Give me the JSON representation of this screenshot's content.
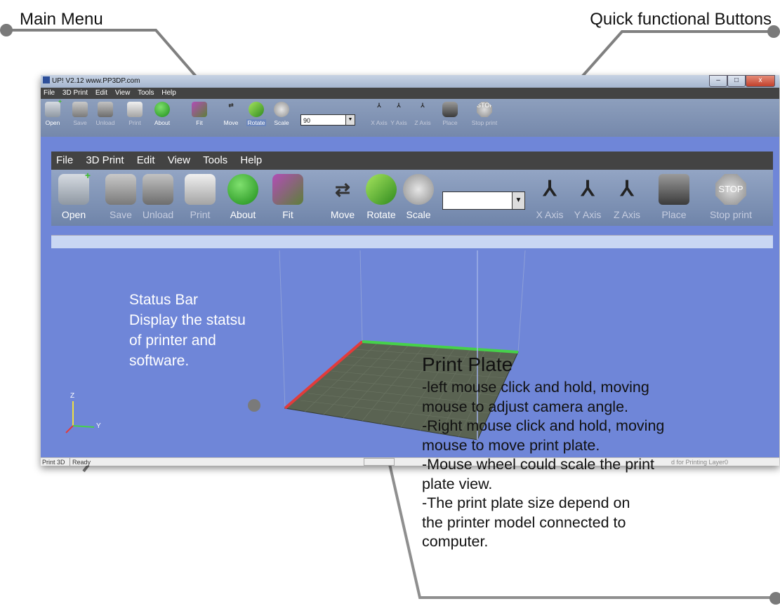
{
  "callouts": {
    "main_menu": "Main Menu",
    "quick_buttons": "Quick functional Buttons",
    "status_bar": [
      "Status Bar",
      "Display the statsu",
      "of printer and",
      "software."
    ],
    "print_plate_title": "Print Plate",
    "print_plate_lines": [
      "-left mouse click and hold, moving",
      "mouse to adjust camera angle.",
      "-Right mouse click and hold, moving",
      "mouse to move print plate.",
      "-Mouse wheel could scale the print",
      "plate view.",
      "-The print plate size depend on",
      "the printer model connected to",
      "computer."
    ]
  },
  "window": {
    "title": "UP!  V2.12 www.PP3DP.com",
    "controls": [
      "–",
      "□",
      "x"
    ]
  },
  "menu": [
    "File",
    "3D Print",
    "Edit",
    "View",
    "Tools",
    "Help"
  ],
  "toolbar": {
    "buttons": [
      {
        "label": "Open",
        "icon": "open-icon",
        "enabled": true
      },
      {
        "label": "Save",
        "icon": "save-icon",
        "enabled": false
      },
      {
        "label": "Unload",
        "icon": "unload-icon",
        "enabled": false
      },
      {
        "label": "Print",
        "icon": "print-icon",
        "enabled": false
      },
      {
        "label": "About",
        "icon": "help-icon",
        "enabled": true
      },
      {
        "label": "Fit",
        "icon": "fit-icon",
        "enabled": true
      },
      {
        "label": "Move",
        "icon": "move-icon",
        "enabled": true
      },
      {
        "label": "Rotate",
        "icon": "rotate-icon",
        "enabled": true
      },
      {
        "label": "Scale",
        "icon": "scale-icon",
        "enabled": true
      },
      {
        "label": "X Axis",
        "icon": "x-axis-icon",
        "enabled": false
      },
      {
        "label": "Y Axis",
        "icon": "y-axis-icon",
        "enabled": false
      },
      {
        "label": "Z Axis",
        "icon": "z-axis-icon",
        "enabled": false
      },
      {
        "label": "Place",
        "icon": "place-icon",
        "enabled": false
      },
      {
        "label": "Stop print",
        "icon": "stop-icon",
        "enabled": false
      }
    ],
    "zoom_value": "90",
    "stop_text": "STOP"
  },
  "viewport": {
    "axis_labels": {
      "z": "Z",
      "y": "Y"
    }
  },
  "statusbar": {
    "mode": "Print 3D",
    "status": "Ready",
    "right_text": "d for Printing Layer0"
  },
  "colors": {
    "viewport_bg": "#6f86d8",
    "plate": "#5a6352",
    "plate_edge_red": "#e23b3b",
    "plate_edge_green": "#46d14a"
  }
}
